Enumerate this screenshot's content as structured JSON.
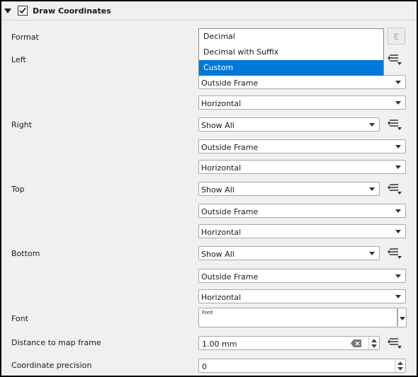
{
  "group": {
    "title": "Draw Coordinates",
    "checked": true
  },
  "labels": {
    "format": "Format",
    "left": "Left",
    "right": "Right",
    "top": "Top",
    "bottom": "Bottom",
    "font": "Font",
    "distance": "Distance to map frame",
    "precision": "Coordinate precision"
  },
  "format_popup": {
    "options": [
      "Decimal",
      "Decimal with Suffix",
      "Custom"
    ],
    "selected": "Custom"
  },
  "left": {
    "position": "Outside Frame",
    "direction": "Horizontal"
  },
  "right": {
    "display": "Show All",
    "position": "Outside Frame",
    "direction": "Horizontal"
  },
  "top": {
    "display": "Show All",
    "position": "Outside Frame",
    "direction": "Horizontal"
  },
  "bottom": {
    "display": "Show All",
    "position": "Outside Frame",
    "direction": "Horizontal"
  },
  "font": {
    "value": "Font"
  },
  "distance": {
    "value": "1.00 mm"
  },
  "precision": {
    "value": "0"
  },
  "icons": {
    "collapse": "chevron-down-icon",
    "checkbox": "checkmark-icon",
    "expression": "epsilon-icon",
    "data_defined": "data-defined-override-icon",
    "clear": "clear-icon"
  },
  "colors": {
    "selection": "#0078d7",
    "panel_bg": "#f0f0f0"
  }
}
